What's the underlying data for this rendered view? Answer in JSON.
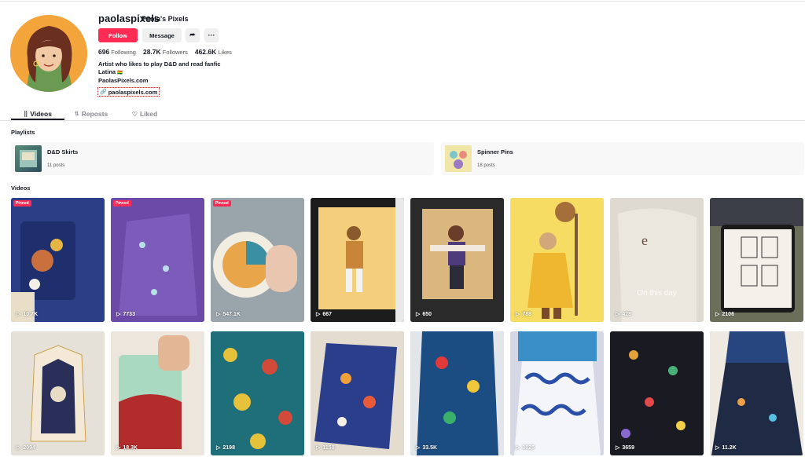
{
  "profile": {
    "username": "paolaspixels",
    "display_name": "Paola's Pixels",
    "follow_label": "Follow",
    "message_label": "Message",
    "share_label": "⮫",
    "more_label": "···",
    "stats": {
      "following_count": "696",
      "following_label": "Following",
      "followers_count": "28.7K",
      "followers_label": "Followers",
      "likes_count": "462.6K",
      "likes_label": "Likes"
    },
    "bio": {
      "line1": "Artist who likes to play D&D and read fanfic",
      "line2": "Latina",
      "line2_suffix": "🇧🇴",
      "line3": "PaolasPixels.com"
    },
    "link_label": "paolaspixels.com"
  },
  "tabs": [
    {
      "label": "Videos",
      "icon": "grid-icon",
      "glyph": "⣿"
    },
    {
      "label": "Reposts",
      "icon": "repost-icon",
      "glyph": "⇅"
    },
    {
      "label": "Liked",
      "icon": "heart-icon",
      "glyph": "♡"
    }
  ],
  "playlists_title": "Playlists",
  "playlists": [
    {
      "name": "D&D Skirts",
      "count": "11 posts"
    },
    {
      "name": "Spinner Pins",
      "count": "18 posts"
    }
  ],
  "videos_title": "Videos",
  "pinned_label": "Pinned",
  "videos": [
    {
      "views": "10.7K",
      "pinned": true,
      "color": "#2c3f86"
    },
    {
      "views": "7733",
      "pinned": true,
      "color": "#6c4aa8"
    },
    {
      "views": "547.1K",
      "pinned": true,
      "color": "#9aa4ab"
    },
    {
      "views": "667",
      "pinned": false,
      "color": "#1c1c1c"
    },
    {
      "views": "650",
      "pinned": false,
      "color": "#2a2a2a"
    },
    {
      "views": "788",
      "pinned": false,
      "color": "#f6dc63"
    },
    {
      "views": "428",
      "pinned": false,
      "color": "#dedad2",
      "overlay": "On this day"
    },
    {
      "views": "2106",
      "pinned": false,
      "color": "#6b6f5a"
    },
    {
      "views": "2094",
      "pinned": false,
      "color": "#d8d2c8"
    },
    {
      "views": "18.3K",
      "pinned": false,
      "color": "#7c9b84"
    },
    {
      "views": "2198",
      "pinned": false,
      "color": "#1f6f7a"
    },
    {
      "views": "1150",
      "pinned": false,
      "color": "#2b3e8c"
    },
    {
      "views": "33.5K",
      "pinned": false,
      "color": "#1b4c82"
    },
    {
      "views": "3025",
      "pinned": false,
      "color": "#d5d8e4"
    },
    {
      "views": "3659",
      "pinned": false,
      "color": "#1a1a22"
    },
    {
      "views": "11.2K",
      "pinned": false,
      "color": "#27457e"
    }
  ],
  "colors": {
    "accent": "#fe2c55",
    "button_bg": "#efefef",
    "avatar_bg": "#f3a43a"
  }
}
